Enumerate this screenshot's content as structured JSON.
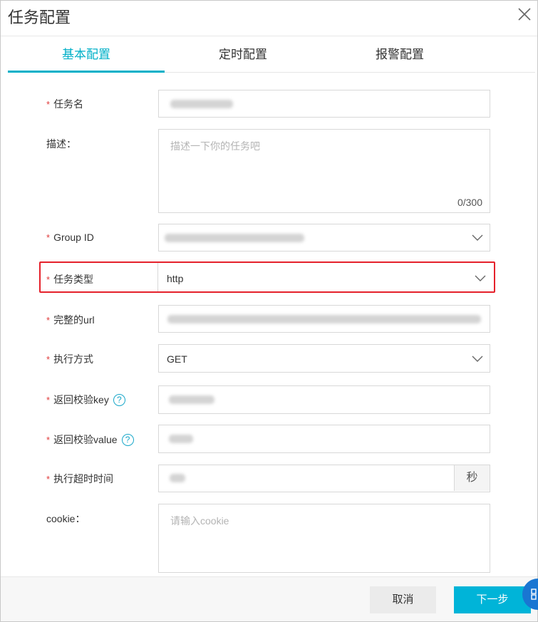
{
  "dialog": {
    "title": "任务配置",
    "close_icon": "close-icon"
  },
  "tabs": [
    {
      "label": "基本配置",
      "active": true
    },
    {
      "label": "定时配置",
      "active": false
    },
    {
      "label": "报警配置",
      "active": false
    }
  ],
  "form": {
    "task_name": {
      "label": "任务名",
      "required": true
    },
    "description": {
      "label": "描述：",
      "placeholder": "描述一下你的任务吧",
      "counter": "0/300"
    },
    "group_id": {
      "label": "Group ID",
      "required": true
    },
    "task_type": {
      "label": "任务类型",
      "required": true,
      "value": "http"
    },
    "full_url": {
      "label": "完整的url",
      "required": true
    },
    "method": {
      "label": "执行方式",
      "required": true,
      "value": "GET"
    },
    "return_key": {
      "label": "返回校验key",
      "required": true,
      "help": "?"
    },
    "return_value": {
      "label": "返回校验value",
      "required": true,
      "help": "?"
    },
    "timeout": {
      "label": "执行超时时间",
      "required": true,
      "suffix": "秒"
    },
    "cookie": {
      "label": "cookie：",
      "placeholder": "请输入cookie"
    }
  },
  "footer": {
    "cancel_label": "取消",
    "next_label": "下一步"
  },
  "colors": {
    "accent": "#00b0c8",
    "required_star": "#e03b3b",
    "highlight_border": "#e5212b",
    "primary_button": "#00b4d8"
  }
}
